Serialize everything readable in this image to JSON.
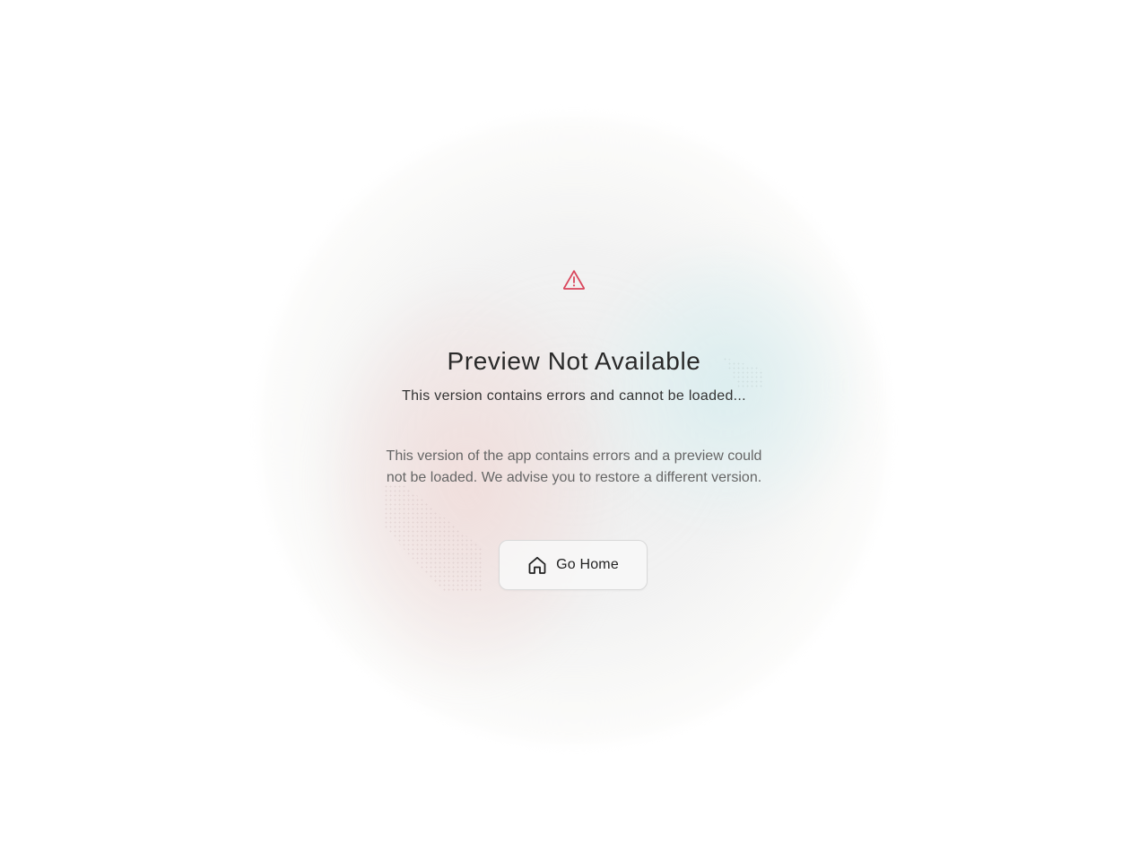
{
  "error": {
    "icon": "warning-triangle-icon",
    "icon_color": "#d9455b",
    "title": "Preview Not Available",
    "subtitle": "This version contains errors and cannot be loaded...",
    "description": "This version of the app contains errors and a preview could not be loaded. We advise you to restore a different version."
  },
  "actions": {
    "home_label": "Go Home",
    "home_icon": "home-icon"
  }
}
